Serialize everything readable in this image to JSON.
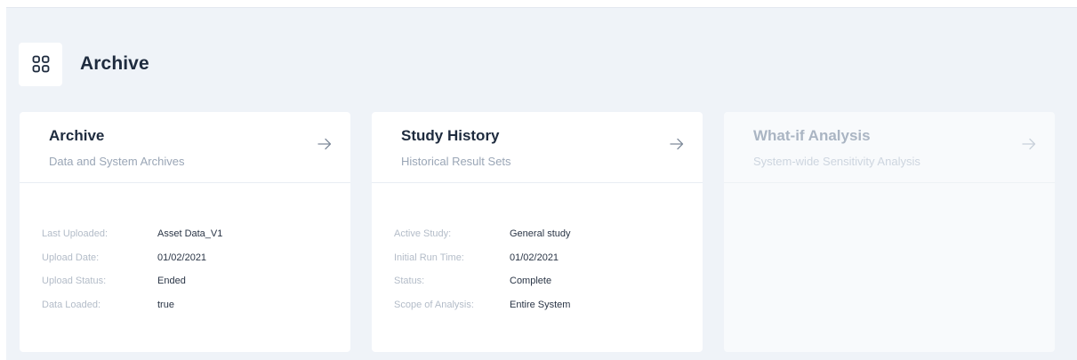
{
  "header": {
    "icon": "grid-icon",
    "title": "Archive"
  },
  "cards": [
    {
      "title": "Archive",
      "subtitle": "Data and System Archives",
      "arrow_icon": "arrow-right-icon",
      "rows": [
        {
          "label": "Last Uploaded:",
          "value": "Asset Data_V1"
        },
        {
          "label": "Upload Date:",
          "value": "01/02/2021"
        },
        {
          "label": "Upload Status:",
          "value": "Ended"
        },
        {
          "label": "Data Loaded:",
          "value": "true"
        }
      ]
    },
    {
      "title": "Study History",
      "subtitle": "Historical Result Sets",
      "arrow_icon": "arrow-right-icon",
      "rows": [
        {
          "label": "Active Study:",
          "value": "General study"
        },
        {
          "label": "Initial Run Time:",
          "value": "01/02/2021"
        },
        {
          "label": "Status:",
          "value": "Complete"
        },
        {
          "label": "Scope of Analysis:",
          "value": "Entire System"
        }
      ]
    },
    {
      "title": "What-if Analysis",
      "subtitle": "System-wide Sensitivity Analysis",
      "arrow_icon": "arrow-right-icon",
      "disabled": true,
      "rows": []
    }
  ],
  "colors": {
    "panel_background": "#eff3f8",
    "card_background": "#ffffff",
    "title_text": "#1e2b3e",
    "subtitle_text": "#9aa6b6",
    "label_text": "#b3bcc8",
    "value_text": "#2a3546"
  }
}
